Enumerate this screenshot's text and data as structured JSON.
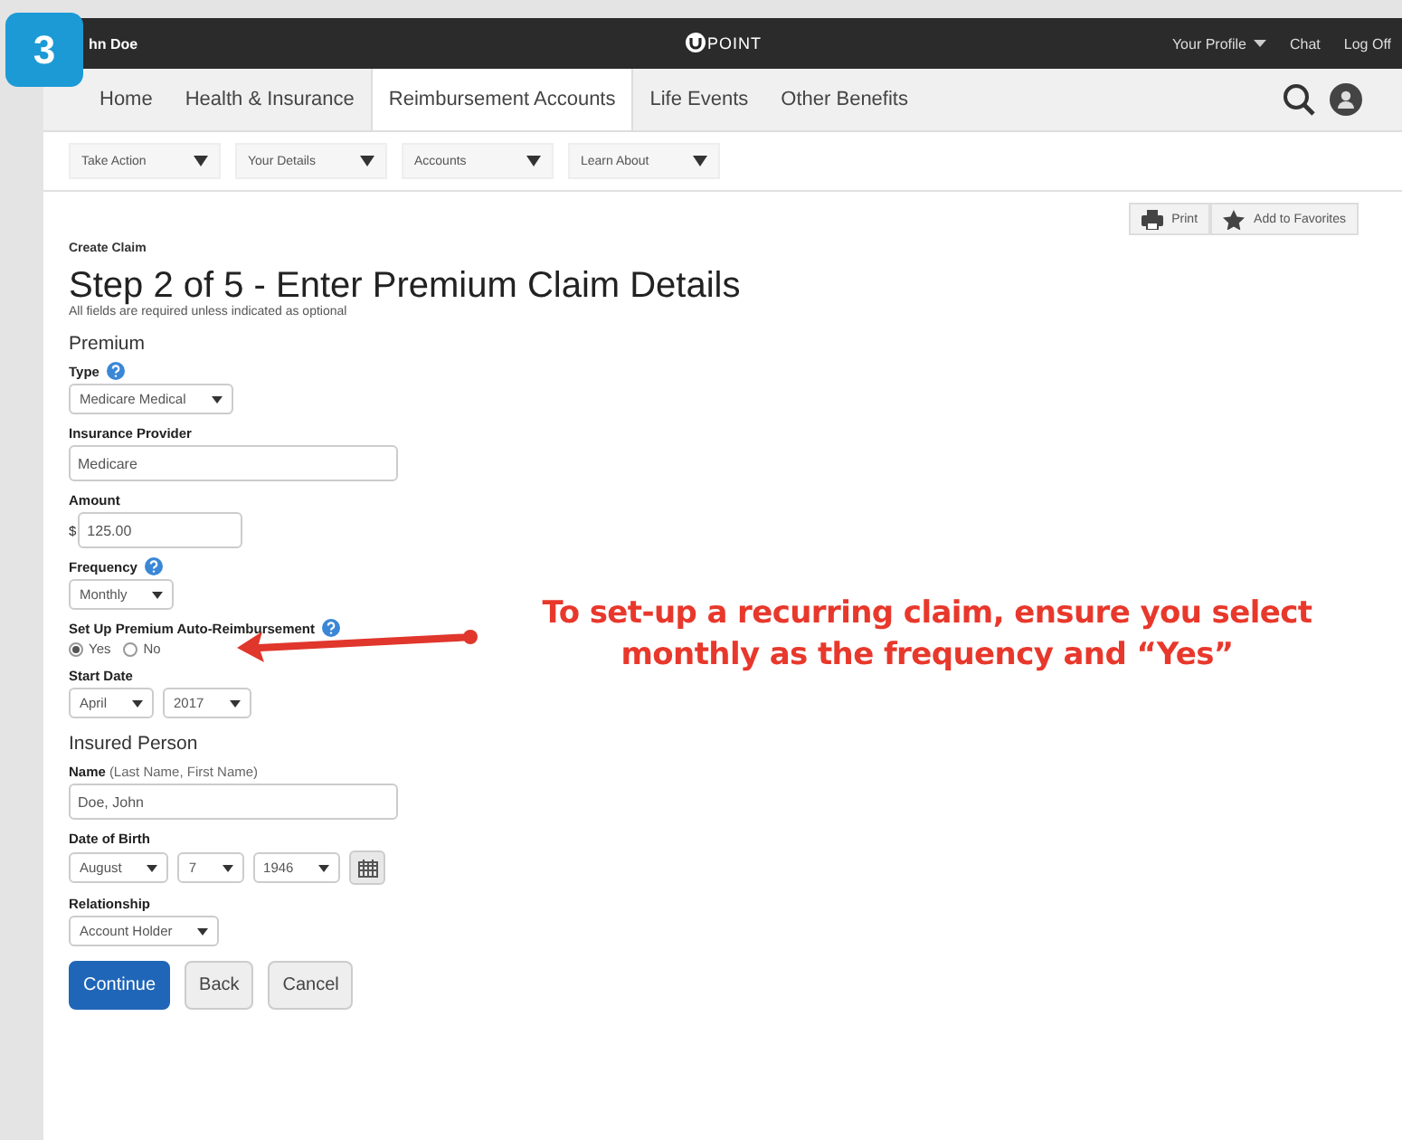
{
  "step_badge": "3",
  "top_bar": {
    "user": "hn Doe",
    "logo": "POINT",
    "links": [
      {
        "label": "Your Profile",
        "kind": "menu"
      },
      {
        "label": "Chat",
        "kind": "link"
      },
      {
        "label": "Log Off",
        "kind": "link"
      }
    ]
  },
  "nav": {
    "tabs": [
      {
        "label": "Home",
        "selected": false
      },
      {
        "label": "Health & Insurance",
        "selected": false
      },
      {
        "label": "Reimbursement Accounts",
        "selected": true
      },
      {
        "label": "Life Events",
        "selected": false
      },
      {
        "label": "Other Benefits",
        "selected": false
      }
    ]
  },
  "sub_nav": [
    "Take Action",
    "Your Details",
    "Accounts",
    "Learn About"
  ],
  "tools": [
    "Print",
    "Add to Favorites"
  ],
  "breadcrumb": "Create Claim",
  "title": "Step 2 of 5 - Enter Premium Claim Details",
  "subtitle": "All fields are required unless indicated as optional",
  "sections": [
    {
      "heading": "Premium",
      "fields": [
        {
          "kind": "select",
          "label": "Type",
          "help": true,
          "controls": [
            {
              "value": "Medicare Medical"
            }
          ]
        },
        {
          "kind": "text",
          "label": "Insurance Provider",
          "value": "Medicare"
        },
        {
          "kind": "money",
          "label": "Amount",
          "prefix": "$",
          "value": "125.00"
        },
        {
          "kind": "select",
          "label": "Frequency",
          "help": true,
          "controls": [
            {
              "value": "Monthly"
            }
          ]
        },
        {
          "kind": "radio",
          "label": "Set Up Premium Auto-Reimbursement",
          "help": true,
          "options": [
            {
              "label": "Yes",
              "selected": true
            },
            {
              "label": "No",
              "selected": false
            }
          ]
        },
        {
          "kind": "select",
          "label": "Start Date",
          "controls": [
            {
              "value": "April"
            },
            {
              "value": "2017"
            }
          ]
        }
      ]
    },
    {
      "heading": "Insured Person",
      "fields": [
        {
          "kind": "text",
          "label": "Name",
          "hint": "(Last Name, First Name)",
          "value": "Doe, John"
        },
        {
          "kind": "select",
          "label": "Date of Birth",
          "calendar": true,
          "controls": [
            {
              "value": "August"
            },
            {
              "value": "7"
            },
            {
              "value": "1946"
            }
          ]
        },
        {
          "kind": "select",
          "label": "Relationship",
          "controls": [
            {
              "value": "Account Holder"
            }
          ]
        }
      ]
    }
  ],
  "buttons": [
    {
      "label": "Continue",
      "kind": "primary"
    },
    {
      "label": "Back",
      "kind": "default"
    },
    {
      "label": "Cancel",
      "kind": "default"
    }
  ],
  "annotation": "To set-up a recurring claim, ensure you select monthly as the frequency and “Yes”"
}
